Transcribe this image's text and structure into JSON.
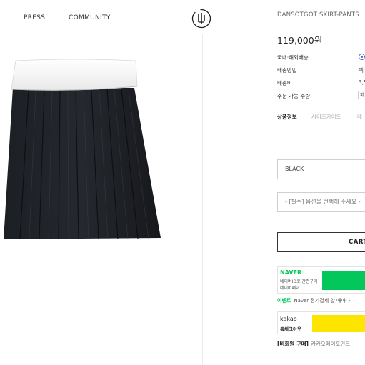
{
  "nav": {
    "items": [
      "PRESS",
      "COMMUNITY"
    ]
  },
  "logo": {
    "icon": "brand-logo-icon"
  },
  "product": {
    "brand_name": "DANSOTGOT SKIRT-PANTS",
    "price": "119,000원",
    "info": [
      {
        "label": "국내·해외배송",
        "value": ""
      },
      {
        "label": "배송방법",
        "value": "택"
      },
      {
        "label": "배송비",
        "value": "3,5"
      },
      {
        "label": "주문 가능 수량",
        "value": "제"
      }
    ],
    "tabs": [
      "상품정보",
      "사이즈가이드",
      "배"
    ],
    "color_option": "BLACK",
    "size_placeholder": "- [필수] 옵션을 선택해 주세요 -",
    "cart_label": "CART"
  },
  "payments": {
    "naver": {
      "logo": "NAVER",
      "sub1": "네이버ID로 간편구매",
      "sub2": "네이버페이"
    },
    "event": {
      "tag": "이벤트",
      "text": "Naver 정기결제 할 때마다"
    },
    "kakao": {
      "logo": "kakao",
      "sub": "톡체크아웃"
    },
    "guest": {
      "tag": "[비회원 구매]",
      "text": "카카오페이포인트"
    }
  },
  "colors": {
    "naver_green": "#03c75a",
    "kakao_yellow": "#fee500",
    "radio_blue": "#3a6fd8"
  }
}
